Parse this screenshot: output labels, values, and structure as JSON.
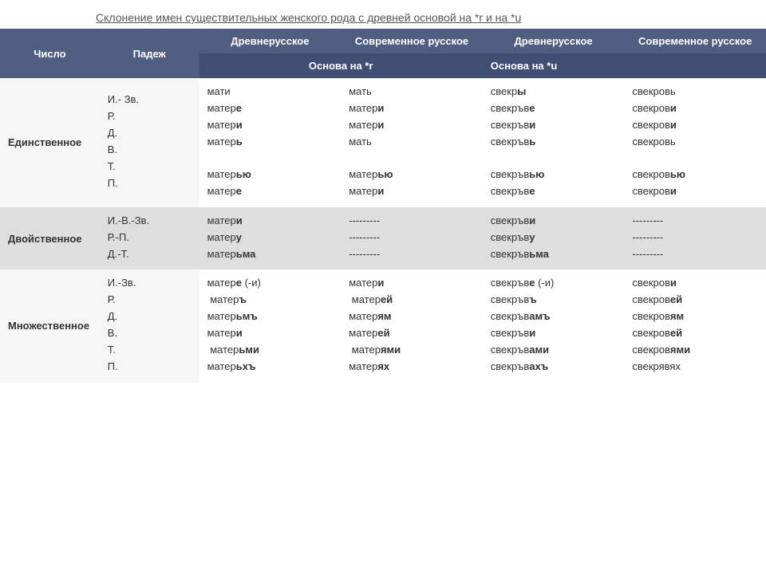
{
  "title": "Склонение имен существительных женского рода с древней основой на *r  и  на *u",
  "header": {
    "num": "Число",
    "case": "Падеж",
    "col1": "Древнерусское",
    "col2": "Современное русское",
    "col3": "Древнерусское",
    "col4": "Современное русское",
    "basis_r": "Основа на *r",
    "basis_u": "Основа на *u"
  },
  "rows": {
    "sg": {
      "label": "Единственное",
      "cases": [
        "И.- Зв.",
        "Р.",
        "Д.",
        "В.",
        "Т.",
        "П."
      ],
      "c1": [
        [
          "мати",
          ""
        ],
        [
          "матер",
          "е"
        ],
        [
          "матер",
          "и"
        ],
        [
          "матер",
          "ь"
        ],
        [
          "",
          ""
        ],
        [
          "матер",
          "ью"
        ],
        [
          "матер",
          "е"
        ]
      ],
      "c2": [
        [
          "мать",
          ""
        ],
        [
          "матер",
          "и"
        ],
        [
          "матер",
          "и"
        ],
        [
          "мать",
          ""
        ],
        [
          "",
          ""
        ],
        [
          "матер",
          "ью"
        ],
        [
          "матер",
          "и"
        ]
      ],
      "c3": [
        [
          "свекр",
          "ы"
        ],
        [
          "свекръв",
          "е"
        ],
        [
          "свекръв",
          "и"
        ],
        [
          "свекръв",
          "ь"
        ],
        [
          "",
          ""
        ],
        [
          "свекръв",
          "ью"
        ],
        [
          "свекръв",
          "е"
        ]
      ],
      "c4": [
        [
          "свекровь",
          ""
        ],
        [
          "свекров",
          "и"
        ],
        [
          "свекров",
          "и"
        ],
        [
          "свекровь",
          ""
        ],
        [
          "",
          ""
        ],
        [
          "свекров",
          "ью"
        ],
        [
          "свекров",
          "и"
        ]
      ]
    },
    "du": {
      "label": "Двойственное",
      "cases": [
        "И.-В.-Зв.",
        "Р.-П.",
        "Д.-Т."
      ],
      "c1": [
        [
          "матер",
          "и"
        ],
        [
          "матер",
          "у"
        ],
        [
          "матер",
          "ьма"
        ]
      ],
      "c2": [
        [
          "---------",
          ""
        ],
        [
          "---------",
          ""
        ],
        [
          "---------",
          ""
        ]
      ],
      "c3": [
        [
          "свекръв",
          "и"
        ],
        [
          "свекръв",
          "у"
        ],
        [
          "свекръв",
          "ьма"
        ]
      ],
      "c4": [
        [
          "---------",
          ""
        ],
        [
          "---------",
          ""
        ],
        [
          "---------",
          ""
        ]
      ]
    },
    "pl": {
      "label": "Множественное",
      "cases": [
        "И.-Зв.",
        "Р.",
        "Д.",
        "В.",
        "Т.",
        "П."
      ],
      "c1": [
        [
          "матер",
          "е",
          " (-и)"
        ],
        [
          " матер",
          "ъ"
        ],
        [
          "матер",
          "ьмъ"
        ],
        [
          "матер",
          "и"
        ],
        [
          " матер",
          "ьми"
        ],
        [
          "матер",
          "ьхъ"
        ]
      ],
      "c2": [
        [
          "матер",
          "и"
        ],
        [
          " матер",
          "ей"
        ],
        [
          "матер",
          "ям"
        ],
        [
          "матер",
          "ей"
        ],
        [
          " матер",
          "ями"
        ],
        [
          "матер",
          "ях"
        ]
      ],
      "c3": [
        [
          "свекръв",
          "е",
          " (-и)"
        ],
        [
          "свекръв",
          "ъ"
        ],
        [
          "свекръв",
          "амъ"
        ],
        [
          "свекръв",
          "и"
        ],
        [
          "свекръв",
          "ами"
        ],
        [
          "свекръв",
          "ахъ"
        ]
      ],
      "c4": [
        [
          "свекров",
          "и"
        ],
        [
          "свекров",
          "ей"
        ],
        [
          "свекров",
          "ям"
        ],
        [
          "свекров",
          "ей"
        ],
        [
          "свекров",
          "ями"
        ],
        [
          "свекрявях",
          ""
        ]
      ]
    }
  }
}
